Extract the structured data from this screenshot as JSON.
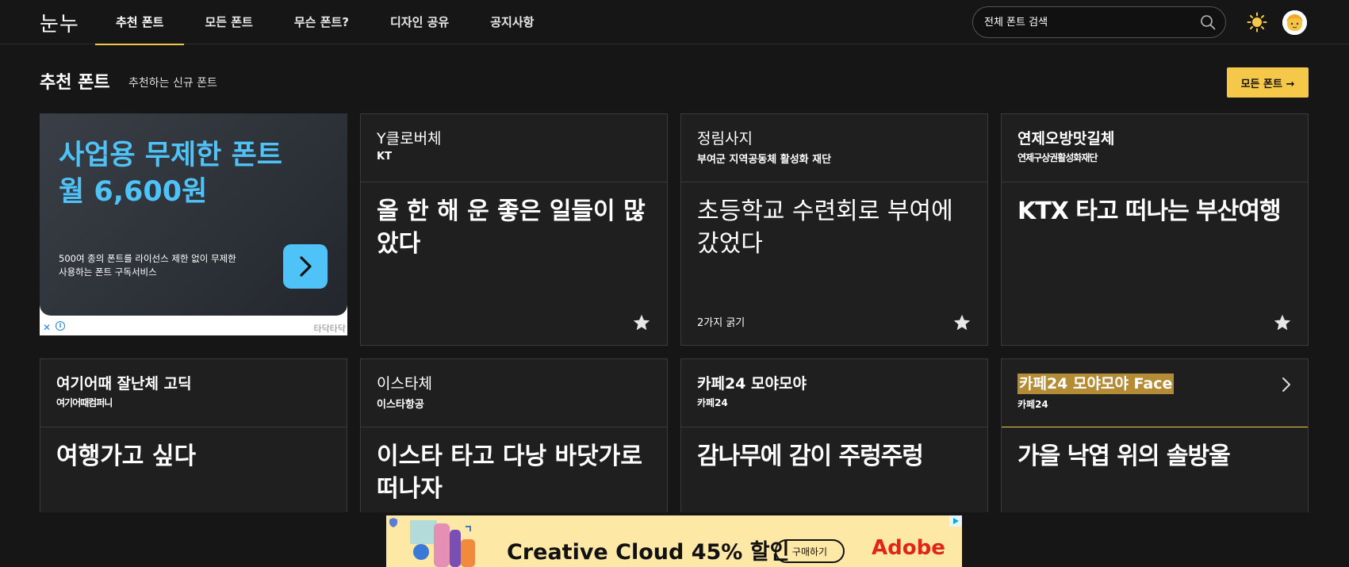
{
  "header": {
    "logo": "눈누",
    "nav": [
      "추천 폰트",
      "모든 폰트",
      "무슨 폰트?",
      "디자인 공유",
      "공지사항"
    ],
    "search_placeholder": "전체 폰트 검색"
  },
  "section": {
    "title": "추천 폰트",
    "subtitle": "추천하는 신규 폰트",
    "all_button": "모든 폰트 →"
  },
  "ad": {
    "headline1": "사업용 무제한 폰트",
    "headline2": "월 6,600원",
    "desc1": "500여 종의 폰트를 라이선스 제한 없이 무제한",
    "desc2": "사용하는 폰트 구독서비스",
    "close": "✕",
    "info": "i",
    "brand": "타닥타닥"
  },
  "cards": [
    {
      "name": "Y클로버체",
      "maker": "KT",
      "sample": "올 한 해 운 좋은 일들이 많았다",
      "weights": ""
    },
    {
      "name": "정림사지",
      "maker": "부여군 지역공동체 활성화 재단",
      "sample": "초등학교 수련회로 부여에 갔었다",
      "weights": "2가지 굵기"
    },
    {
      "name": "연제오방맛길체",
      "maker": "연제구상권활성화재단",
      "sample": "KTX 타고 떠나는 부산여행",
      "weights": ""
    },
    {
      "name": "여기어때 잘난체 고딕",
      "maker": "여기어때컴퍼니",
      "sample": "여행가고 싶다",
      "weights": ""
    },
    {
      "name": "이스타체",
      "maker": "이스타항공",
      "sample": "이스타 타고 다낭 바닷가로 떠나자",
      "weights": ""
    },
    {
      "name": "카페24 모야모야",
      "maker": "카페24",
      "sample": "감나무에 감이 주렁주렁",
      "weights": ""
    },
    {
      "name": "카페24 모야모야 Face",
      "maker": "카페24",
      "sample": "가을 낙엽 위의 솔방울",
      "weights": ""
    }
  ],
  "banner": {
    "text": "Creative Cloud 45% 할인",
    "button": "구매하기",
    "brand": "Adobe"
  },
  "colors": {
    "accent": "#f5c84a",
    "ad_blue": "#4fc3f7",
    "background": "#161616",
    "card": "#1f1f1f",
    "adobe_red": "#e1251b"
  }
}
